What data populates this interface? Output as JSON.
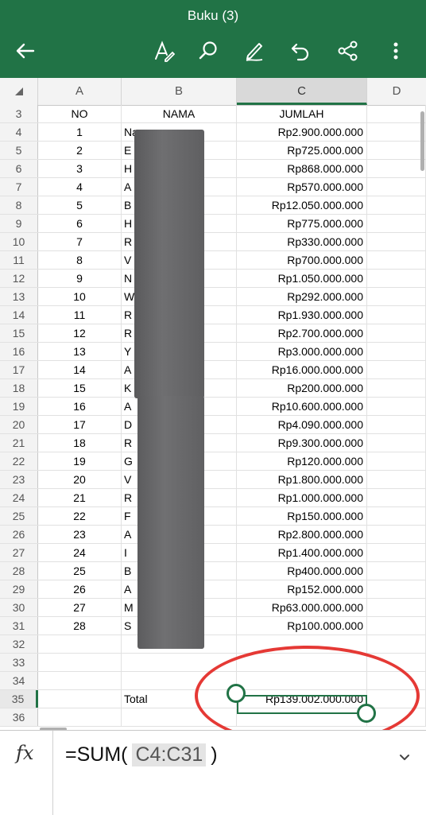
{
  "app": {
    "title": "Buku (3)",
    "accent_color": "#217346",
    "icons": [
      "back-arrow-icon",
      "text-format-icon",
      "search-icon",
      "draw-pen-icon",
      "undo-icon",
      "share-icon",
      "more-vertical-icon"
    ]
  },
  "sheet": {
    "columns": [
      "A",
      "B",
      "C",
      "D"
    ],
    "selected_column": "C",
    "rows": [
      {
        "n": "3",
        "a": "NO",
        "b": "NAMA",
        "c": "JUMLAH"
      },
      {
        "n": "4",
        "a": "1",
        "b": "Na",
        "c": "Rp2.900.000.000"
      },
      {
        "n": "5",
        "a": "2",
        "b": "E",
        "c": "Rp725.000.000"
      },
      {
        "n": "6",
        "a": "3",
        "b": "H",
        "c": "Rp868.000.000"
      },
      {
        "n": "7",
        "a": "4",
        "b": "A",
        "c": "Rp570.000.000"
      },
      {
        "n": "8",
        "a": "5",
        "b": "B",
        "c": "Rp12.050.000.000"
      },
      {
        "n": "9",
        "a": "6",
        "b": "H",
        "c": "Rp775.000.000"
      },
      {
        "n": "10",
        "a": "7",
        "b": "R",
        "c": "Rp330.000.000"
      },
      {
        "n": "11",
        "a": "8",
        "b": "V",
        "c": "Rp700.000.000"
      },
      {
        "n": "12",
        "a": "9",
        "b": "N",
        "c": "Rp1.050.000.000"
      },
      {
        "n": "13",
        "a": "10",
        "b": "W",
        "c": "Rp292.000.000"
      },
      {
        "n": "14",
        "a": "11",
        "b": "R",
        "c": "Rp1.930.000.000"
      },
      {
        "n": "15",
        "a": "12",
        "b": "R",
        "c": "Rp2.700.000.000"
      },
      {
        "n": "16",
        "a": "13",
        "b": "Y",
        "c": "Rp3.000.000.000"
      },
      {
        "n": "17",
        "a": "14",
        "b": "A",
        "c": "Rp16.000.000.000"
      },
      {
        "n": "18",
        "a": "15",
        "b": "K",
        "c": "Rp200.000.000"
      },
      {
        "n": "19",
        "a": "16",
        "b": "A",
        "c": "Rp10.600.000.000"
      },
      {
        "n": "20",
        "a": "17",
        "b": "D",
        "c": "Rp4.090.000.000"
      },
      {
        "n": "21",
        "a": "18",
        "b": "R",
        "c": "Rp9.300.000.000"
      },
      {
        "n": "22",
        "a": "19",
        "b": "G",
        "c": "Rp120.000.000"
      },
      {
        "n": "23",
        "a": "20",
        "b": "V",
        "c": "Rp1.800.000.000"
      },
      {
        "n": "24",
        "a": "21",
        "b": "R",
        "c": "Rp1.000.000.000"
      },
      {
        "n": "25",
        "a": "22",
        "b": "F",
        "c": "Rp150.000.000"
      },
      {
        "n": "26",
        "a": "23",
        "b": "A",
        "c": "Rp2.800.000.000"
      },
      {
        "n": "27",
        "a": "24",
        "b": "I",
        "c": "Rp1.400.000.000"
      },
      {
        "n": "28",
        "a": "25",
        "b": "B",
        "c": "Rp400.000.000"
      },
      {
        "n": "29",
        "a": "26",
        "b": "A",
        "c": "Rp152.000.000"
      },
      {
        "n": "30",
        "a": "27",
        "b": "M",
        "c": "Rp63.000.000.000"
      },
      {
        "n": "31",
        "a": "28",
        "b": "S",
        "c": "Rp100.000.000"
      },
      {
        "n": "32",
        "a": "",
        "b": "",
        "c": ""
      },
      {
        "n": "33",
        "a": "",
        "b": "",
        "c": ""
      },
      {
        "n": "34",
        "a": "",
        "b": "",
        "c": ""
      },
      {
        "n": "35",
        "a": "",
        "b": "Total",
        "c": "Rp139.002.000.000"
      },
      {
        "n": "36",
        "a": "",
        "b": "",
        "c": ""
      }
    ],
    "selected_cell": "C35",
    "annotation_color": "#e53935"
  },
  "formula_bar": {
    "prefix": "=SUM(",
    "range": "C4:C31",
    "suffix": ")"
  }
}
